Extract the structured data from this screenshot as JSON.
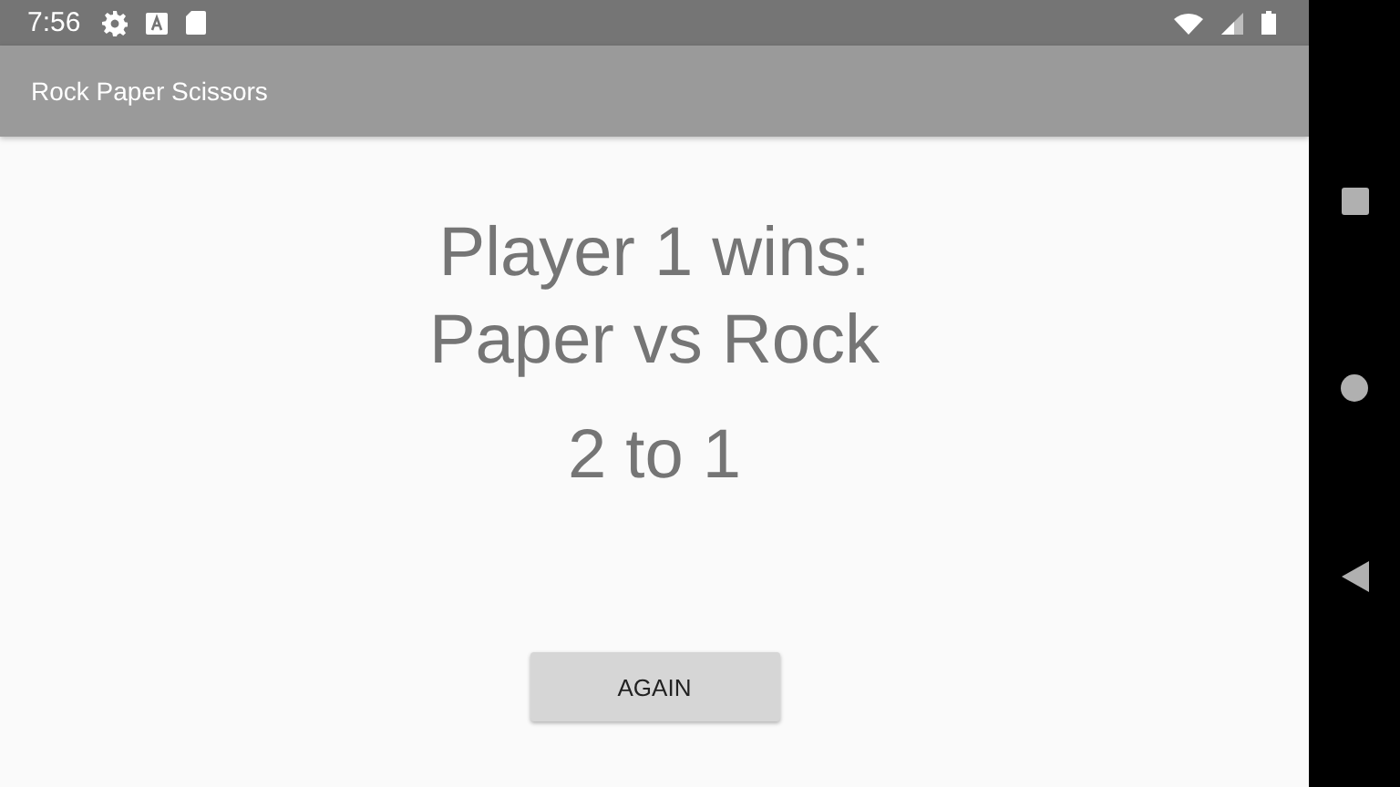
{
  "status_bar": {
    "time": "7:56"
  },
  "app_bar": {
    "title": "Rock Paper Scissors"
  },
  "result": {
    "headline": "Player 1 wins:\nPaper vs Rock",
    "score": "2 to 1"
  },
  "buttons": [
    "AGAIN"
  ]
}
